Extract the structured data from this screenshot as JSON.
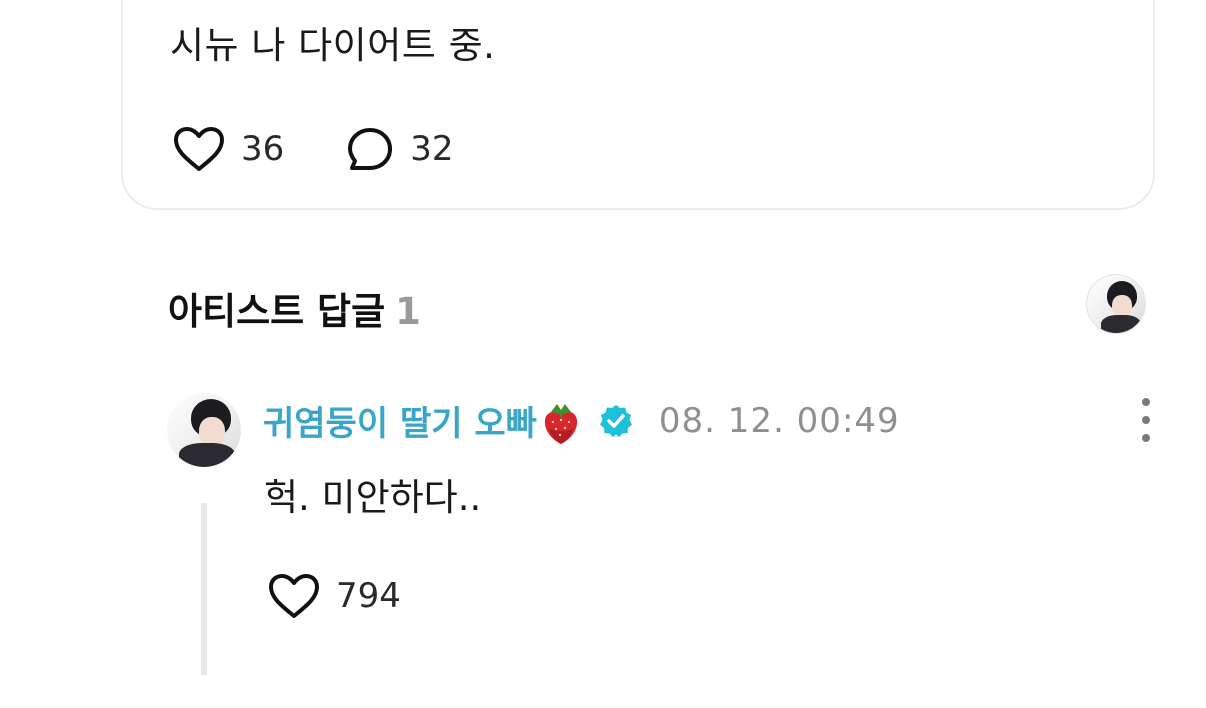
{
  "post": {
    "text": "시뉴 나 다이어트 중.",
    "like_count": "36",
    "comment_count": "32",
    "icons": {
      "like": "heart-icon",
      "comment": "speech-bubble-icon"
    }
  },
  "artist_replies": {
    "title": "아티스트 답글",
    "count": "1"
  },
  "reply": {
    "author": "귀염둥이 딸기 오빠",
    "author_emoji": "strawberry-icon",
    "verified": true,
    "timestamp": "08. 12. 00:49",
    "text": "헉. 미안하다..",
    "like_count": "794"
  },
  "colors": {
    "author_name": "#3aa5c6",
    "verified_badge": "#1ec1d8",
    "muted_text": "#8f8f8f",
    "thread_line": "#e9e9ec"
  }
}
